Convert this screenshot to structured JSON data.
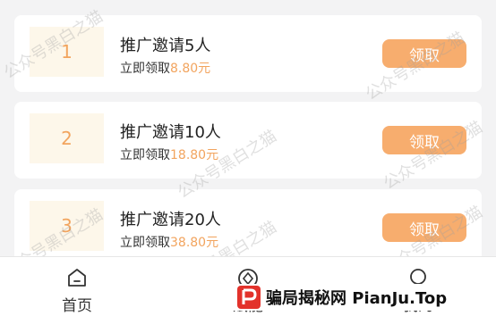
{
  "rewards": [
    {
      "rank": "1",
      "title": "推广邀请5人",
      "sub_prefix": "立即领取",
      "amount": "8.80元",
      "button": "领取"
    },
    {
      "rank": "2",
      "title": "推广邀请10人",
      "sub_prefix": "立即领取",
      "amount": "18.80元",
      "button": "领取"
    },
    {
      "rank": "3",
      "title": "推广邀请20人",
      "sub_prefix": "立即领取",
      "amount": "38.80元",
      "button": "领取"
    }
  ],
  "watermark": "公众号黑白之猫",
  "tabs": [
    {
      "label": "首页",
      "icon": "home-icon"
    },
    {
      "label": "赋能",
      "icon": "empower-icon"
    },
    {
      "label": "我的",
      "icon": "user-icon"
    }
  ],
  "banner": {
    "logo": "P",
    "text": "骗局揭秘网 PianJu.Top"
  },
  "colors": {
    "accent": "#f7ad6e",
    "amount": "#f2a45e",
    "rank_bg": "#fdf7ea"
  }
}
